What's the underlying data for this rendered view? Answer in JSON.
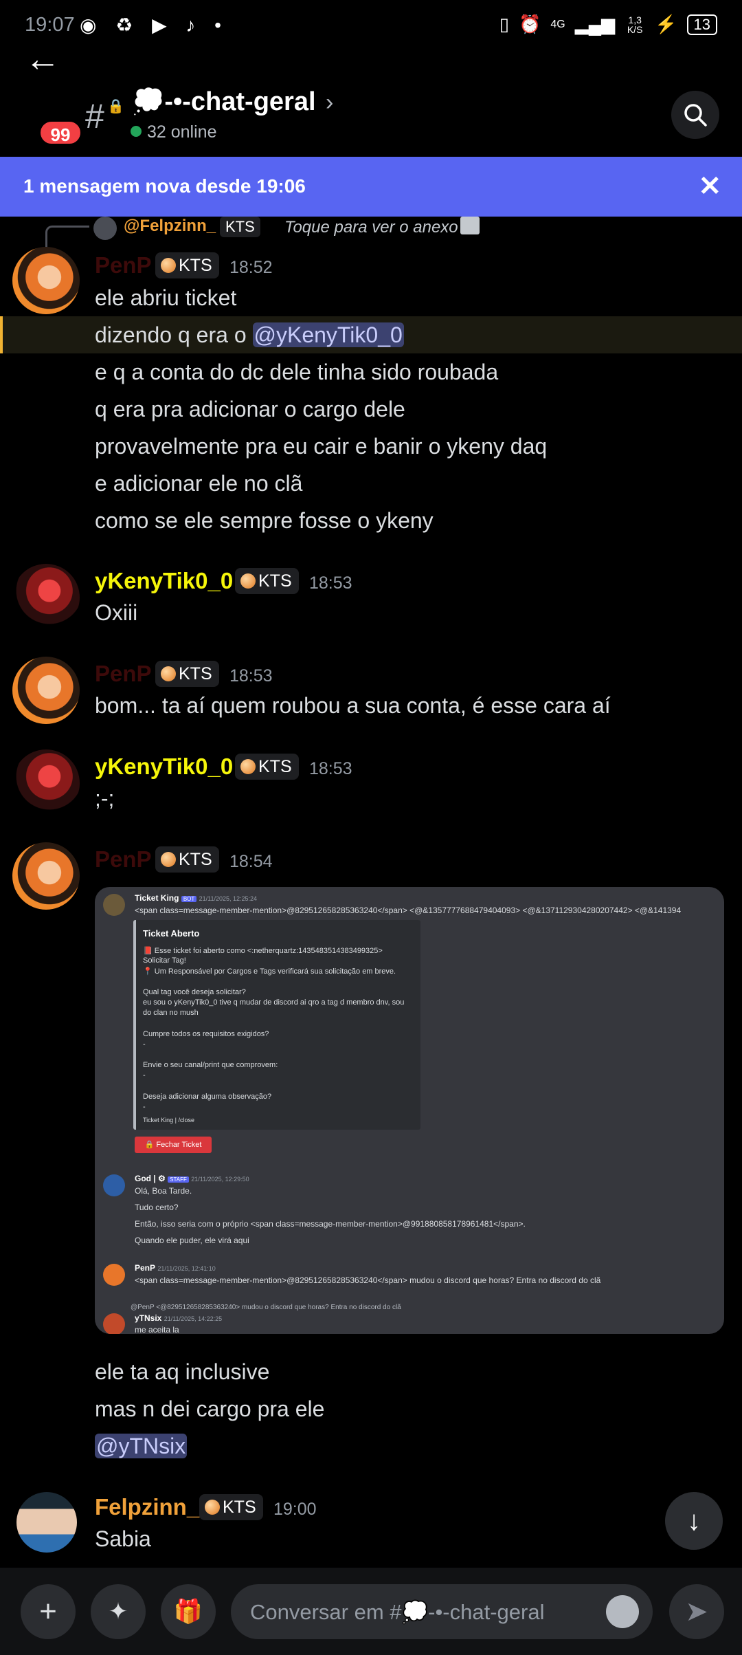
{
  "status_bar": {
    "time": "19:07",
    "network": "4G",
    "speed": "1,3 K/S",
    "battery": "13"
  },
  "header": {
    "unread_count": "99",
    "channel_name": "💭-•-chat-geral",
    "online": "32 online"
  },
  "new_messages_bar": {
    "text": "1 mensagem nova desde 19:06"
  },
  "reply_preview": {
    "author": "@Felpzinn_",
    "tag": "KTS",
    "text": "Toque para ver o anexo"
  },
  "messages": [
    {
      "author": "PenP",
      "tag": "KTS",
      "time": "18:52",
      "lines": [
        "ele abriu ticket",
        "dizendo q era o ",
        "e q a conta do dc dele tinha sido roubada",
        "q era pra adicionar o cargo dele",
        "provavelmente pra eu cair e banir o ykeny daq",
        "e adicionar ele no clã",
        "como se ele sempre fosse o ykeny"
      ],
      "mention": "@yKenyTik0_0"
    },
    {
      "author": "yKenyTik0_0",
      "tag": "KTS",
      "time": "18:53",
      "lines": [
        "Oxiii"
      ]
    },
    {
      "author": "PenP",
      "tag": "KTS",
      "time": "18:53",
      "lines": [
        "bom... ta aí quem roubou a sua conta, é esse cara aí"
      ]
    },
    {
      "author": "yKenyTik0_0",
      "tag": "KTS",
      "time": "18:53",
      "lines": [
        ";-;"
      ]
    },
    {
      "author": "PenP",
      "tag": "KTS",
      "time": "18:54",
      "lines": [
        "ele ta aq inclusive",
        "mas n dei cargo pra ele"
      ],
      "mention": "@yTNsix"
    },
    {
      "author": "Felpzinn_",
      "tag": "KTS",
      "time": "19:00",
      "lines": [
        "Sabia"
      ]
    }
  ],
  "attachment": {
    "bot_name": "Ticket King",
    "bot_badge": "BOT",
    "bot_date": "21/11/2025, 12:25:24",
    "mentions_line": "<span class=message-member-mention>@829512658285363240</span> <@&1357777688479404093> <@&1371129304280207442> <@&141394",
    "card_title": "Ticket Aberto",
    "card_lines": [
      "📕 Esse ticket foi aberto como <:netherquartz:1435483514383499325>",
      "Solicitar Tag!",
      "📍 Um Responsável por Cargos e Tags verificará sua solicitação em breve.",
      "Qual tag você deseja solicitar?",
      "eu sou o yKenyTik0_0 tive q mudar de discord ai qro a tag d membro dnv, sou",
      "do clan no mush",
      "Cumpre todos os requisitos exigidos?",
      "-",
      "Envie o seu canal/print que comprovem:",
      "-",
      "Deseja adicionar alguma observação?",
      "-",
      "Ticket King | /close"
    ],
    "button": "🔒 Fechar Ticket",
    "god_name": "God | ⚙",
    "god_badge": "STAFF",
    "god_date": "21/11/2025, 12:29:50",
    "god_lines": [
      "Olá, Boa Tarde.",
      "Tudo certo?",
      "Então, isso seria com o próprio <span class=message-member-mention>@991880858178961481</span>.",
      "Quando ele puder, ele virá aqui"
    ],
    "penp_name": "PenP",
    "penp_date": "21/11/2025, 12:41:10",
    "penp_line": "<span class=message-member-mention>@829512658285363240</span> mudou o discord que horas? Entra no discord do clã",
    "reply_line": "@PenP <@829512658285363240> mudou o discord que horas? Entra no discord do clã",
    "ytn_name": "yTNsix",
    "ytn_date": "21/11/2025, 14:22:25",
    "ytn_line": "me aceita la"
  },
  "composer": {
    "placeholder": "Conversar em #💭-•-chat-geral"
  }
}
